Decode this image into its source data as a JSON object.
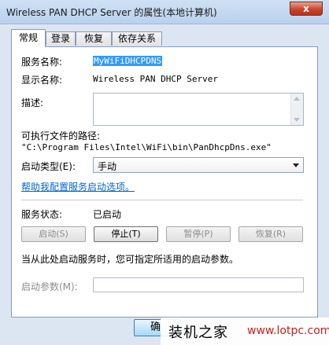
{
  "window": {
    "title": "Wireless PAN DHCP Server 的属性(本地计算机)",
    "close_symbol": "x"
  },
  "tabs": [
    {
      "label": "常规",
      "active": true
    },
    {
      "label": "登录",
      "active": false
    },
    {
      "label": "恢复",
      "active": false
    },
    {
      "label": "依存关系",
      "active": false
    }
  ],
  "general": {
    "service_name_label": "服务名称:",
    "service_name_value": "MyWiFiDHCPDNS",
    "display_name_label": "显示名称:",
    "display_name_value": "Wireless PAN DHCP Server",
    "description_label": "描述:",
    "path_label": "可执行文件的路径:",
    "path_value": "\"C:\\Program Files\\Intel\\WiFi\\bin\\PanDhcpDns.exe\"",
    "startup_type_label": "启动类型(E):",
    "startup_type_value": "手动",
    "help_link": "帮助我配置服务启动选项。",
    "status_label": "服务状态:",
    "status_value": "已启动",
    "buttons": {
      "start": "启动(S)",
      "stop": "停止(T)",
      "pause": "暂停(P)",
      "resume": "恢复(R)"
    },
    "hint": "当从此处启动服务时，您可指定所适用的启动参数。",
    "start_params_label": "启动参数(M):"
  },
  "footer": {
    "ok_partial": "确"
  },
  "watermark": {
    "text": "装机之家",
    "url": "www.lotpc.com"
  }
}
